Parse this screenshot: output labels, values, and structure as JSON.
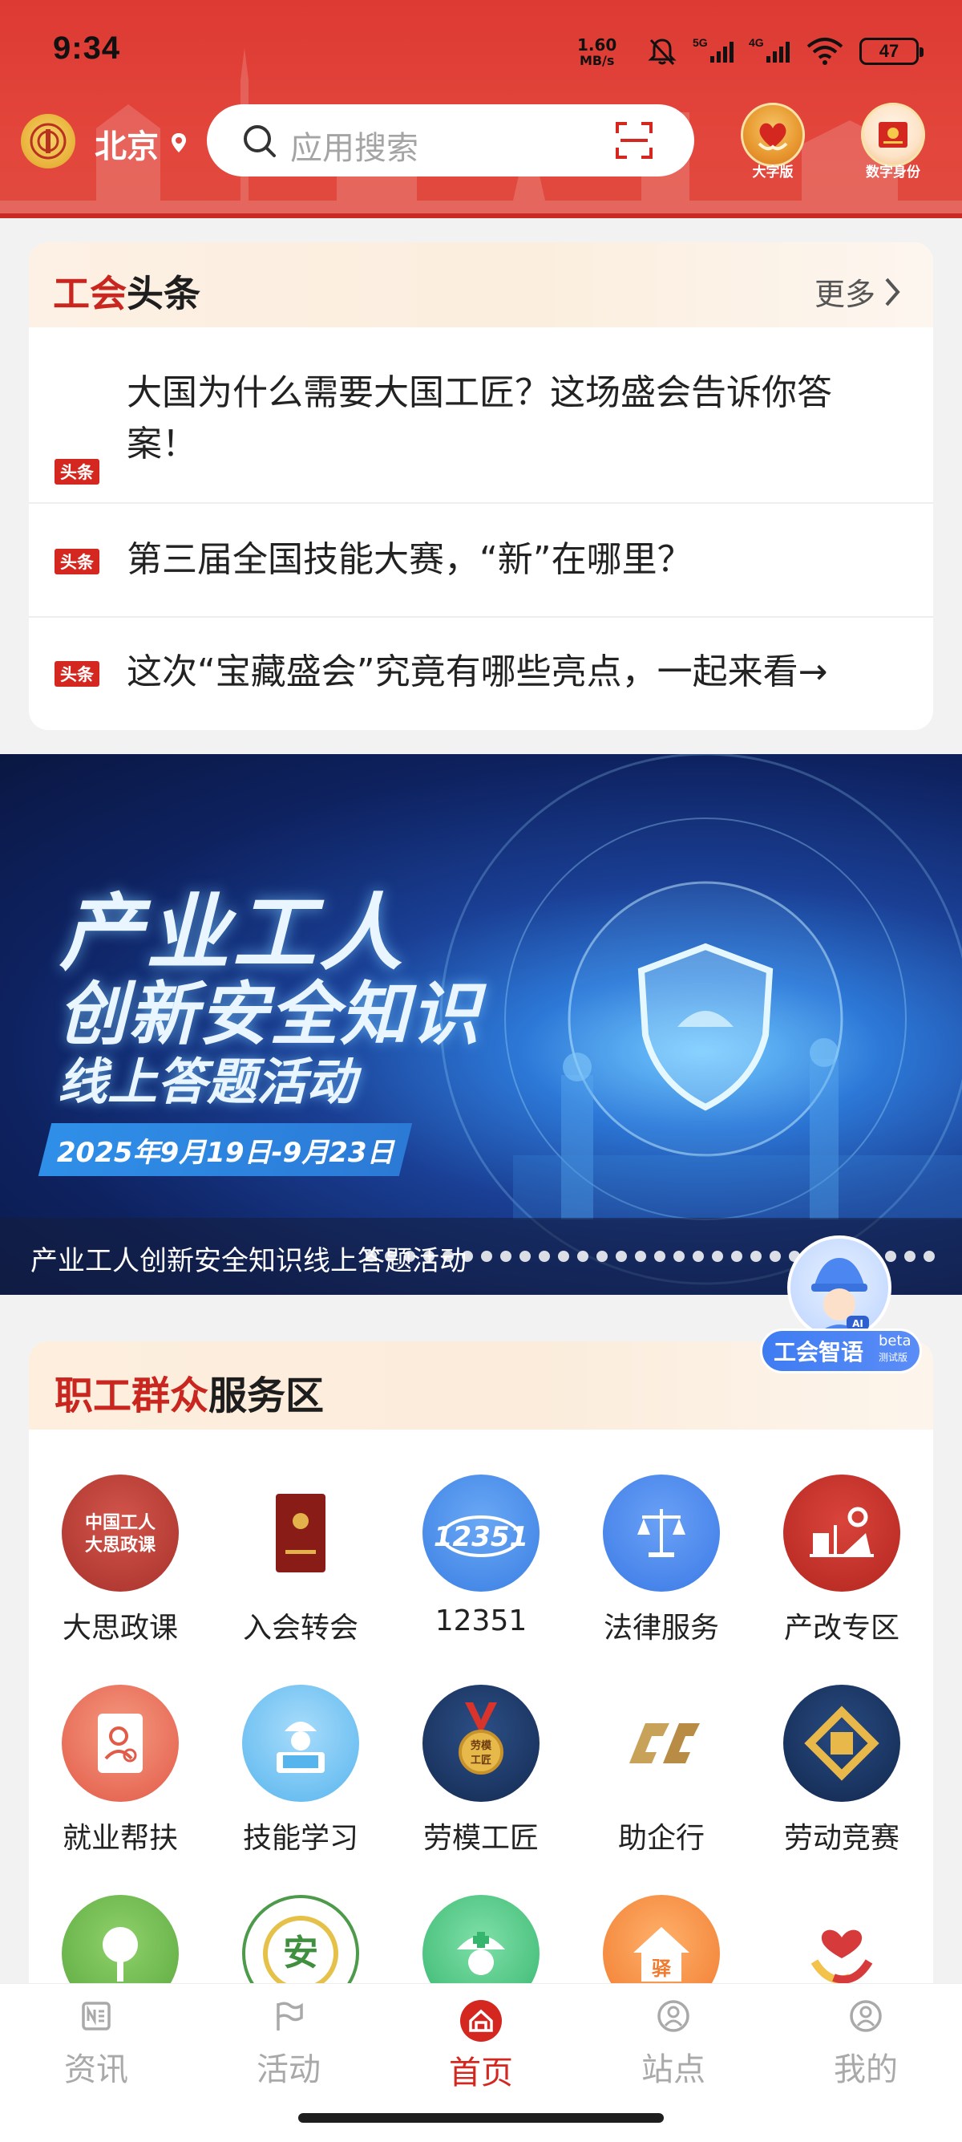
{
  "status_bar": {
    "time": "9:34",
    "speed_value": "1.60",
    "speed_unit": "MB/s",
    "battery": "47"
  },
  "header": {
    "city": "北京",
    "search_placeholder": "应用搜索",
    "big_font_label": "大字版",
    "digital_id_label": "数字身份"
  },
  "news": {
    "title_red": "工会",
    "title_dark": "头条",
    "more_label": "更多",
    "items": [
      {
        "tag": "头条",
        "text": "大国为什么需要大国工匠？这场盛会告诉你答案！"
      },
      {
        "tag": "头条",
        "text": "第三届全国技能大赛，“新”在哪里？"
      },
      {
        "tag": "头条",
        "text": "这次“宝藏盛会”究竟有哪些亮点，一起来看→"
      }
    ]
  },
  "banner": {
    "line1": "产业工人",
    "line2": "创新安全知识",
    "line3": "线上答题活动",
    "date": "2025年9月19日-9月23日",
    "caption": "产业工人创新安全知识线上答题活动"
  },
  "ai_assistant": {
    "label": "工会智语",
    "badge": "beta",
    "badge_sub": "测试版"
  },
  "service": {
    "title_red": "职工群众",
    "title_dark": "服务区",
    "items": [
      {
        "label": "大思政课",
        "icon": "ideology-course-icon",
        "color": "#b83a34"
      },
      {
        "label": "入会转会",
        "icon": "member-book-icon",
        "color": "#8a1c17"
      },
      {
        "label": "12351",
        "icon": "hotline-12351-icon",
        "color": "#3d84e6"
      },
      {
        "label": "法律服务",
        "icon": "scales-icon",
        "color": "#3f7fe8"
      },
      {
        "label": "产改专区",
        "icon": "reform-zone-icon",
        "color": "#c72e26"
      },
      {
        "label": "就业帮扶",
        "icon": "employment-icon",
        "color": "#ea6a55"
      },
      {
        "label": "技能学习",
        "icon": "skill-learning-icon",
        "color": "#5bb8f0"
      },
      {
        "label": "劳模工匠",
        "icon": "model-worker-medal-icon",
        "color": "#1e3a6b"
      },
      {
        "label": "助企行",
        "icon": "enterprise-logo-icon",
        "color": "#c9a25a"
      },
      {
        "label": "劳动竞赛",
        "icon": "labor-competition-icon",
        "color": "#1e3a6b"
      },
      {
        "label": "",
        "icon": "tree-icon",
        "color": "#6ab54a"
      },
      {
        "label": "",
        "icon": "safety-health-icon",
        "color": "#4c9a4a"
      },
      {
        "label": "",
        "icon": "medical-icon",
        "color": "#3fbf7f"
      },
      {
        "label": "",
        "icon": "station-house-icon",
        "color": "#f08a3a"
      },
      {
        "label": "",
        "icon": "care-hands-icon",
        "color": "#d63a3a"
      }
    ]
  },
  "bottom_nav": {
    "items": [
      {
        "label": "资讯",
        "icon": "news-icon"
      },
      {
        "label": "活动",
        "icon": "flag-icon"
      },
      {
        "label": "首页",
        "icon": "home-icon"
      },
      {
        "label": "站点",
        "icon": "station-icon"
      },
      {
        "label": "我的",
        "icon": "profile-icon"
      }
    ],
    "active": "首页"
  }
}
